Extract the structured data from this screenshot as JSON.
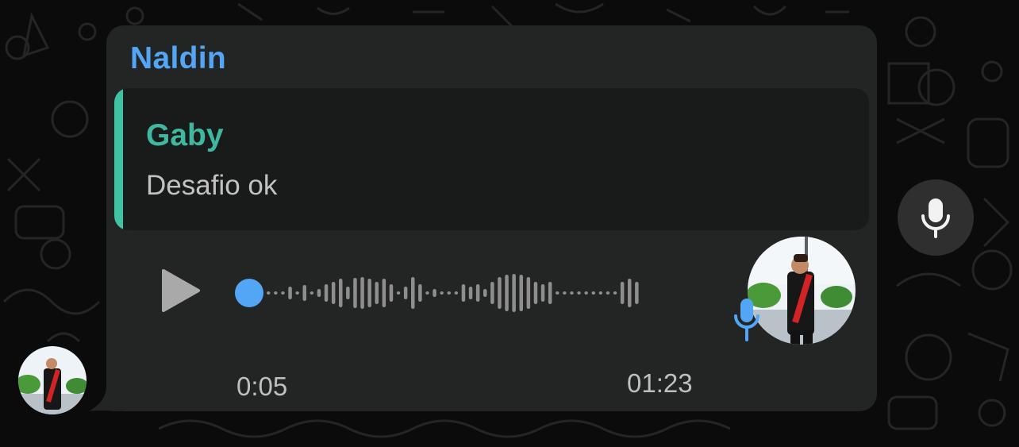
{
  "message": {
    "sender": "Naldin",
    "sender_color": "#53a6f5",
    "reply": {
      "author": "Gaby",
      "author_color": "#3fb8a0",
      "bar_color": "#3fc3a3",
      "text": "Desafio ok"
    },
    "voice": {
      "current_time": "0:05",
      "duration": "01:23",
      "progress": 0.06,
      "play_icon": "play-icon",
      "accent_color": "#53a6f5"
    }
  },
  "icons": {
    "record": "microphone-icon",
    "voice_badge": "microphone-icon"
  }
}
